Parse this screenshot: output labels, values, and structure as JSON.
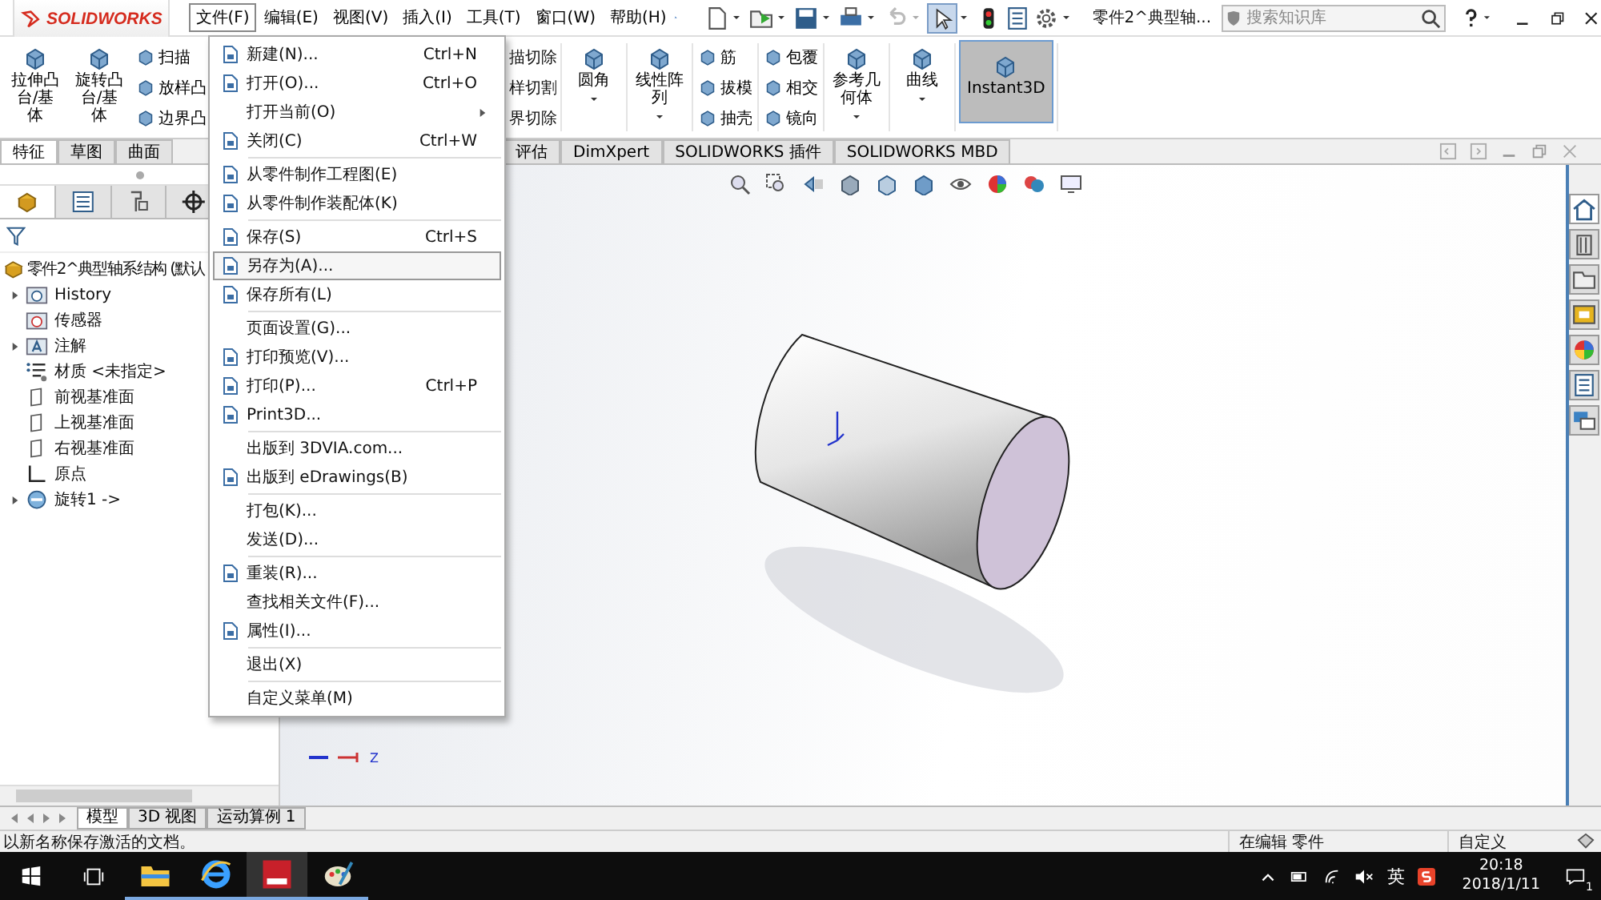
{
  "app": {
    "logo": "SOLIDWORKS"
  },
  "menu_bar": [
    {
      "label": "文件(F)",
      "selected": true
    },
    {
      "label": "编辑(E)",
      "selected": false
    },
    {
      "label": "视图(V)",
      "selected": false
    },
    {
      "label": "插入(I)",
      "selected": false
    },
    {
      "label": "工具(T)",
      "selected": false
    },
    {
      "label": "窗口(W)",
      "selected": false
    },
    {
      "label": "帮助(H)",
      "selected": false
    }
  ],
  "document_title": "零件2^典型轴...",
  "search": {
    "placeholder": "搜索知识库"
  },
  "ribbon": {
    "left": [
      {
        "kind": "large",
        "label": "拉伸凸台/基体",
        "selected": false
      },
      {
        "kind": "large",
        "label": "旋转凸台/基体",
        "selected": false
      },
      {
        "kind": "stack",
        "items": [
          "扫描",
          "放样凸",
          "边界凸"
        ]
      }
    ],
    "right": [
      {
        "kind": "cut",
        "items": [
          "描切除",
          "样切割",
          "界切除"
        ]
      },
      {
        "kind": "large",
        "label": "圆角",
        "selected": false,
        "dropdown": true
      },
      {
        "kind": "large",
        "label": "线性阵列",
        "selected": false,
        "dropdown": true
      },
      {
        "kind": "stack",
        "items": [
          "筋",
          "拔模",
          "抽壳"
        ]
      },
      {
        "kind": "stack",
        "items": [
          "包覆",
          "相交",
          "镜向"
        ]
      },
      {
        "kind": "large",
        "label": "参考几何体",
        "selected": false,
        "dropdown": true
      },
      {
        "kind": "large",
        "label": "曲线",
        "selected": false,
        "dropdown": true
      },
      {
        "kind": "toggle",
        "label": "Instant3D",
        "selected": true
      }
    ]
  },
  "command_tabs": {
    "left": [
      {
        "label": "特征",
        "selected": true
      },
      {
        "label": "草图",
        "selected": false
      },
      {
        "label": "曲面",
        "selected": false
      }
    ],
    "right": [
      {
        "label": "评估",
        "selected": false
      },
      {
        "label": "DimXpert",
        "selected": false
      },
      {
        "label": "SOLIDWORKS 插件",
        "selected": false
      },
      {
        "label": "SOLIDWORKS MBD",
        "selected": false
      }
    ]
  },
  "file_menu": {
    "groups": [
      [
        {
          "label": "新建(N)...",
          "shortcut": "Ctrl+N",
          "icon": true,
          "selected": false
        },
        {
          "label": "打开(O)...",
          "shortcut": "Ctrl+O",
          "icon": true,
          "selected": false
        },
        {
          "label": "打开当前(O)",
          "icon": false,
          "submenu": true,
          "selected": false
        },
        {
          "label": "关闭(C)",
          "shortcut": "Ctrl+W",
          "icon": true,
          "selected": false
        }
      ],
      [
        {
          "label": "从零件制作工程图(E)",
          "icon": true,
          "selected": false
        },
        {
          "label": "从零件制作装配体(K)",
          "icon": true,
          "selected": false
        }
      ],
      [
        {
          "label": "保存(S)",
          "shortcut": "Ctrl+S",
          "icon": true,
          "selected": false
        },
        {
          "label": "另存为(A)...",
          "icon": true,
          "selected": true
        },
        {
          "label": "保存所有(L)",
          "icon": true,
          "selected": false
        }
      ],
      [
        {
          "label": "页面设置(G)...",
          "icon": false,
          "selected": false
        },
        {
          "label": "打印预览(V)...",
          "icon": true,
          "selected": false
        },
        {
          "label": "打印(P)...",
          "shortcut": "Ctrl+P",
          "icon": true,
          "selected": false
        },
        {
          "label": "Print3D...",
          "icon": true,
          "selected": false
        }
      ],
      [
        {
          "label": "出版到 3DVIA.com...",
          "icon": false,
          "selected": false
        },
        {
          "label": "出版到 eDrawings(B)",
          "icon": true,
          "selected": false
        }
      ],
      [
        {
          "label": "打包(K)...",
          "icon": false,
          "selected": false
        },
        {
          "label": "发送(D)...",
          "icon": false,
          "selected": false
        }
      ],
      [
        {
          "label": "重装(R)...",
          "icon": true,
          "selected": false
        },
        {
          "label": "查找相关文件(F)...",
          "icon": false,
          "selected": false
        },
        {
          "label": "属性(I)...",
          "icon": true,
          "selected": false
        }
      ],
      [
        {
          "label": "退出(X)",
          "icon": false,
          "selected": false
        }
      ],
      [
        {
          "label": "自定义菜单(M)",
          "icon": false,
          "selected": false
        }
      ]
    ]
  },
  "feature_tree": {
    "root": {
      "label": "零件2^典型轴系结构 (默认",
      "children": [
        {
          "kind": "history",
          "label": "History",
          "expandable": true
        },
        {
          "kind": "sensor",
          "label": "传感器",
          "expandable": false
        },
        {
          "kind": "annotation",
          "label": "注解",
          "expandable": true
        },
        {
          "kind": "material",
          "label": "材质 <未指定>",
          "expandable": false
        },
        {
          "kind": "plane",
          "label": "前视基准面",
          "expandable": false
        },
        {
          "kind": "plane",
          "label": "上视基准面",
          "expandable": false
        },
        {
          "kind": "plane",
          "label": "右视基准面",
          "expandable": false
        },
        {
          "kind": "origin",
          "label": "原点",
          "expandable": false
        },
        {
          "kind": "feature",
          "label": "旋转1 ->",
          "expandable": true
        }
      ]
    }
  },
  "viewport": {
    "triad_label": "Z"
  },
  "bottom_tabs": [
    {
      "label": "模型",
      "selected": true
    },
    {
      "label": "3D 视图",
      "selected": false
    },
    {
      "label": "运动算例 1",
      "selected": false
    }
  ],
  "status_bar": {
    "message": "以新名称保存激活的文档。",
    "mode": "在编辑 零件",
    "units": "自定义"
  },
  "taskbar": {
    "apps": [
      {
        "kind": "explorer",
        "selected": false
      },
      {
        "kind": "ie",
        "selected": false
      },
      {
        "kind": "solidworks",
        "selected": true
      },
      {
        "kind": "paint",
        "selected": false
      }
    ],
    "ime": "英",
    "time": "20:18",
    "date": "2018/1/11",
    "notifications": "1"
  }
}
